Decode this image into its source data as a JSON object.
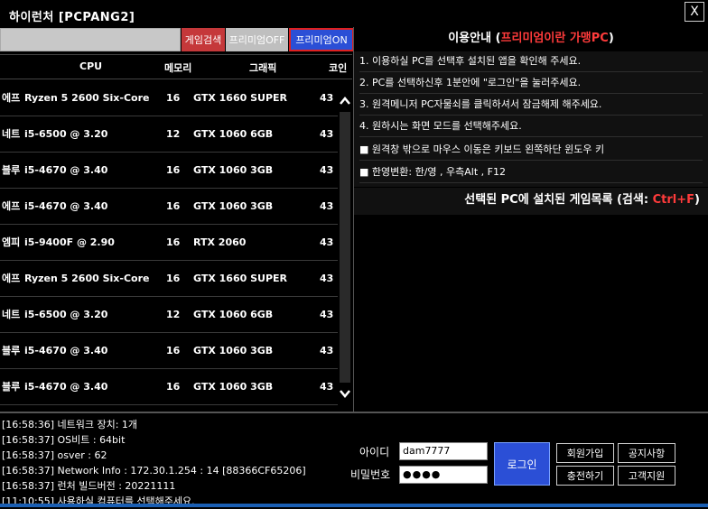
{
  "window": {
    "title": "하이런처 [PCPANG2]",
    "close_label": "X"
  },
  "toolbar": {
    "search_placeholder": "",
    "search_button": "게임검색",
    "premium_off": "프리미엄OFF",
    "premium_on": "프리미엄ON"
  },
  "table": {
    "headers": {
      "cpu": "CPU",
      "memory": "메모리",
      "gpu": "그래픽",
      "coin": "코인"
    },
    "rows": [
      {
        "prefix": "에프",
        "cpu": "Ryzen 5 2600 Six-Core",
        "mem": "16",
        "gpu": "GTX 1660 SUPER",
        "coin": "43"
      },
      {
        "prefix": "네트",
        "cpu": "i5-6500 @ 3.20",
        "mem": "12",
        "gpu": "GTX 1060 6GB",
        "coin": "43"
      },
      {
        "prefix": "블루",
        "cpu": "i5-4670 @ 3.40",
        "mem": "16",
        "gpu": "GTX 1060 3GB",
        "coin": "43"
      },
      {
        "prefix": "에프",
        "cpu": "i5-4670 @ 3.40",
        "mem": "16",
        "gpu": "GTX 1060 3GB",
        "coin": "43"
      },
      {
        "prefix": "엠피",
        "cpu": "i5-9400F @ 2.90",
        "mem": "16",
        "gpu": "RTX 2060",
        "coin": "43"
      },
      {
        "prefix": "에프",
        "cpu": "Ryzen 5 2600 Six-Core",
        "mem": "16",
        "gpu": "GTX 1660 SUPER",
        "coin": "43"
      },
      {
        "prefix": "네트",
        "cpu": "i5-6500 @ 3.20",
        "mem": "12",
        "gpu": "GTX 1060 6GB",
        "coin": "43"
      },
      {
        "prefix": "블루",
        "cpu": "i5-4670 @ 3.40",
        "mem": "16",
        "gpu": "GTX 1060 3GB",
        "coin": "43"
      },
      {
        "prefix": "블루",
        "cpu": "i5-4670 @ 3.40",
        "mem": "16",
        "gpu": "GTX 1060 3GB",
        "coin": "43"
      }
    ]
  },
  "guide": {
    "title_prefix": "이용안내 (",
    "title_accent": "프리미엄이란 가맹PC",
    "title_suffix": ")",
    "lines": [
      "1. 이용하실 PC를 선택후 설치된 앱을 확인해 주세요.",
      "2. PC를 선택하신후 1분안에 \"로그인\"을 눌러주세요.",
      "3. 원격메니저 PC자물쇠를 클릭하셔서 잠금해제 해주세요.",
      "4. 원하시는 화면 모드를 선택해주세요.",
      "■ 원격창 밖으로 마우스 이동은 키보드 왼쪽하단 윈도우 키",
      "■ 한영변환: 한/영 , 우측Alt , F12"
    ],
    "installed_label": "선택된 PC에 설치된 게임목록 (검색: ",
    "installed_key": "Ctrl+F",
    "installed_suffix": ")"
  },
  "log": [
    "[16:58:36] 네트워크 장치: 1개",
    "[16:58:37] OS비트 : 64bit",
    "[16:58:37] osver : 62",
    "[16:58:37] Network Info : 172.30.1.254 : 14 [88366CF65206]",
    "[16:58:37] 런처 빌드버전 : 20221111",
    "[11:10:55] 사용하실 컴퓨터를 선택해주세요."
  ],
  "login": {
    "id_label": "아이디",
    "id_value": "dam7777",
    "pw_label": "비밀번호",
    "pw_value": "●●●●",
    "login_button": "로그인",
    "signup": "회원가입",
    "notice": "공지사항",
    "charge": "충전하기",
    "support": "고객지원"
  }
}
